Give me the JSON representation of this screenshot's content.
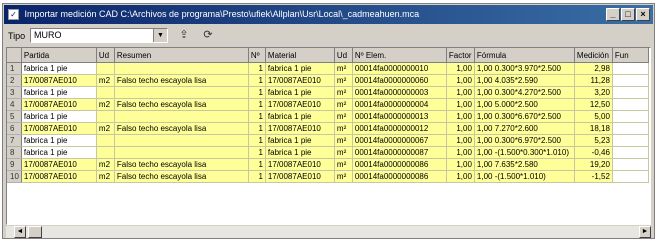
{
  "window": {
    "title": "Importar medición CAD C:\\Archivos de programa\\Presto\\ufiek\\Allplan\\Usr\\Local\\_cadmeahuen.mca",
    "minimize": "_",
    "restore": "□",
    "close": "×"
  },
  "toolbar": {
    "tipo_label": "Tipo",
    "tipo_value": "MURO",
    "tipo_arrow": "▼"
  },
  "table": {
    "columns": [
      "Partida",
      "Ud",
      "Resumen",
      "Nº",
      "Material",
      "Ud",
      "Nº Elem.",
      "Factor",
      "Fórmula",
      "Medición",
      "Fun"
    ],
    "rows": [
      {
        "n": "1",
        "partida": "fabrica 1 pie",
        "ud": "",
        "resumen": "",
        "nro": "1",
        "material": "fabrica 1 pie",
        "ud2": "m²",
        "elem": "00014fa0000000010",
        "factor": "1,00",
        "formula": "1,00 0.300*3.970*2.500",
        "medicion": "2,98",
        "fun": ""
      },
      {
        "n": "2",
        "partida": "17/0087AE010",
        "ud": "m2",
        "resumen": "Falso techo escayola lisa",
        "nro": "1",
        "material": "17/0087AE010",
        "ud2": "m²",
        "elem": "00014fa0000000060",
        "factor": "1,00",
        "formula": "1,00 4.035*2.590",
        "medicion": "11,28",
        "fun": ""
      },
      {
        "n": "3",
        "partida": "fabrica 1 pie",
        "ud": "",
        "resumen": "",
        "nro": "1",
        "material": "fabrica 1 pie",
        "ud2": "m²",
        "elem": "00014fa0000000003",
        "factor": "1,00",
        "formula": "1,00 0.300*4.270*2.500",
        "medicion": "3,20",
        "fun": ""
      },
      {
        "n": "4",
        "partida": "17/0087AE010",
        "ud": "m2",
        "resumen": "Falso techo escayola lisa",
        "nro": "1",
        "material": "17/0087AE010",
        "ud2": "m²",
        "elem": "00014fa0000000004",
        "factor": "1,00",
        "formula": "1,00 5.000*2.500",
        "medicion": "12,50",
        "fun": ""
      },
      {
        "n": "5",
        "partida": "fabrica 1 pie",
        "ud": "",
        "resumen": "",
        "nro": "1",
        "material": "fabrica 1 pie",
        "ud2": "m²",
        "elem": "00014fa0000000013",
        "factor": "1,00",
        "formula": "1,00 0.300*6.670*2.500",
        "medicion": "5,00",
        "fun": ""
      },
      {
        "n": "6",
        "partida": "17/0087AE010",
        "ud": "m2",
        "resumen": "Falso techo escayola lisa",
        "nro": "1",
        "material": "17/0087AE010",
        "ud2": "m²",
        "elem": "00014fa0000000012",
        "factor": "1,00",
        "formula": "1,00 7.270*2.600",
        "medicion": "18,18",
        "fun": ""
      },
      {
        "n": "7",
        "partida": "fabrica 1 pie",
        "ud": "",
        "resumen": "",
        "nro": "1",
        "material": "fabrica 1 pie",
        "ud2": "m²",
        "elem": "00014fa0000000067",
        "factor": "1,00",
        "formula": "1,00 0.300*6.970*2.500",
        "medicion": "5,23",
        "fun": ""
      },
      {
        "n": "8",
        "partida": "fabrica 1 pie",
        "ud": "",
        "resumen": "",
        "nro": "1",
        "material": "fabrica 1 pie",
        "ud2": "m²",
        "elem": "00014fa0000000087",
        "factor": "1,00",
        "formula": "1,00 -(1.500*0.300*1.010)",
        "medicion": "-0,46",
        "fun": ""
      },
      {
        "n": "9",
        "partida": "17/0087AE010",
        "ud": "m2",
        "resumen": "Falso techo escayola lisa",
        "nro": "1",
        "material": "17/0087AE010",
        "ud2": "m²",
        "elem": "00014fa0000000086",
        "factor": "1,00",
        "formula": "1,00 7.635*2.580",
        "medicion": "19,20",
        "fun": ""
      },
      {
        "n": "10",
        "partida": "17/0087AE010",
        "ud": "m2",
        "resumen": "Falso techo escayola lisa",
        "nro": "1",
        "material": "17/0087AE010",
        "ud2": "m²",
        "elem": "00014fa0000000086",
        "factor": "1,00",
        "formula": "1,00 -(1.500*1.010)",
        "medicion": "-1,52",
        "fun": ""
      }
    ]
  },
  "scrollbar": {
    "left": "◄",
    "right": "►"
  }
}
